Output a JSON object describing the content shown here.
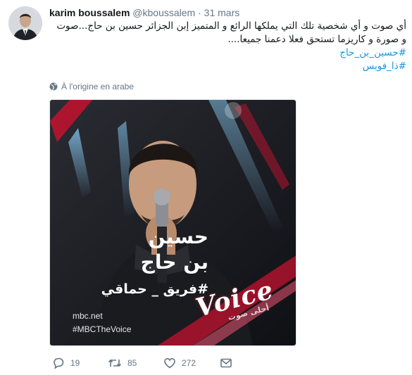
{
  "tweet": {
    "author_name": "karim boussalem",
    "handle": "@kboussalem",
    "separator": "·",
    "date": "31 mars",
    "text_line1": "أي صوت و أي شخصية تلك التي يملكها  الرائع و المتميز إبن  الجزائر حسين بن حاج...صوت",
    "text_line2": "و صورة و كاريزما  تستحق فعلا  دعمنا جميعا....",
    "hashtag1": "#حسين_بن_حاج",
    "hashtag2": "#ذا_فويس",
    "translation_note": "À l'origine en arabe"
  },
  "media": {
    "overlay_name_line1": "حسين",
    "overlay_name_line2": "بن حاج",
    "overlay_team": "#فريق _ حماقي",
    "overlay_site": "mbc.net",
    "overlay_hashtag": "#MBCTheVoice",
    "logo_text": "Voice",
    "logo_subtext": "أحلى صوت",
    "colors": {
      "background": "#1c1d22",
      "accent": "#c4122f",
      "light": "#4fb3e8"
    }
  },
  "actions": {
    "reply_count": "19",
    "retweet_count": "85",
    "like_count": "272",
    "icons": [
      "reply-icon",
      "retweet-icon",
      "like-icon",
      "direct-message-icon"
    ]
  }
}
